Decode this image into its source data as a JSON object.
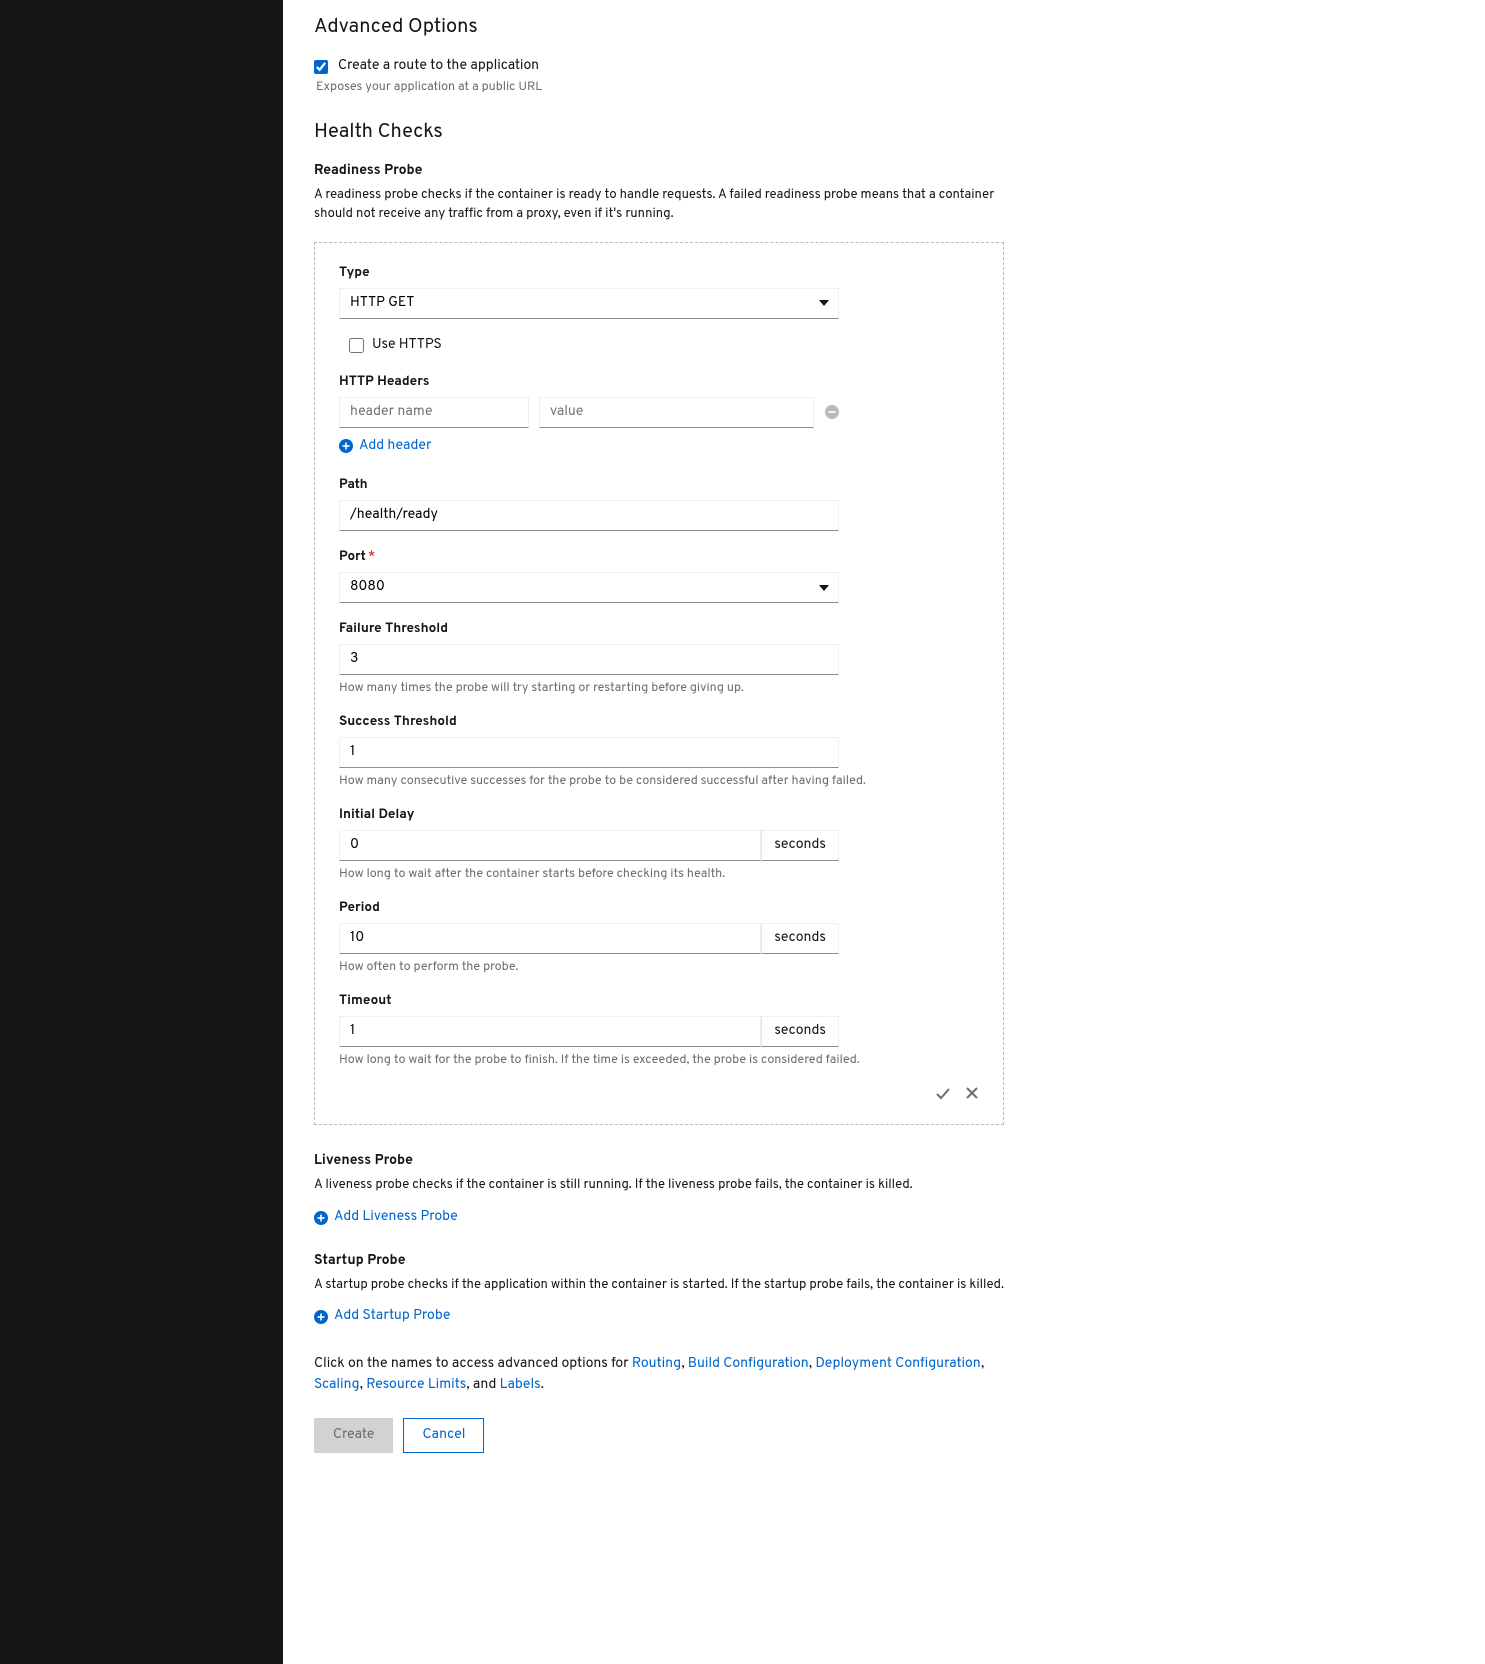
{
  "advanced_options": {
    "title": "Advanced Options",
    "create_route": {
      "label": "Create a route to the application",
      "checked": true,
      "help": "Exposes your application at a public URL"
    }
  },
  "health_checks": {
    "title": "Health Checks",
    "readiness": {
      "heading": "Readiness Probe",
      "description": "A readiness probe checks if the container is ready to handle requests. A failed readiness probe means that a container should not receive any traffic from a proxy, even if it's running.",
      "type_label": "Type",
      "type_value": "HTTP GET",
      "use_https_label": "Use HTTPS",
      "http_headers_label": "HTTP Headers",
      "header_name_placeholder": "header name",
      "header_value_placeholder": "value",
      "add_header_label": "Add header",
      "path_label": "Path",
      "path_value": "/health/ready",
      "port_label": "Port",
      "port_value": "8080",
      "failure_threshold_label": "Failure Threshold",
      "failure_threshold_value": "3",
      "failure_threshold_help": "How many times the probe will try starting or restarting before giving up.",
      "success_threshold_label": "Success Threshold",
      "success_threshold_value": "1",
      "success_threshold_help": "How many consecutive successes for the probe to be considered successful after having failed.",
      "initial_delay_label": "Initial Delay",
      "initial_delay_value": "0",
      "initial_delay_help": "How long to wait after the container starts before checking its health.",
      "period_label": "Period",
      "period_value": "10",
      "period_help": "How often to perform the probe.",
      "timeout_label": "Timeout",
      "timeout_value": "1",
      "timeout_help": "How long to wait for the probe to finish. If the time is exceeded, the probe is considered failed.",
      "seconds_label": "seconds"
    },
    "liveness": {
      "heading": "Liveness Probe",
      "description": "A liveness probe checks if the container is still running. If the liveness probe fails, the container is killed.",
      "add_label": "Add Liveness Probe"
    },
    "startup": {
      "heading": "Startup Probe",
      "description": "A startup probe checks if the application within the container is started. If the startup probe fails, the container is killed.",
      "add_label": "Add Startup Probe"
    }
  },
  "footer": {
    "prefix": "Click on the names to access advanced options for ",
    "links": {
      "routing": "Routing",
      "build": "Build Configuration",
      "deployment": "Deployment Configuration",
      "scaling": "Scaling",
      "resource": "Resource Limits",
      "labels": "Labels"
    },
    "and": ", and "
  },
  "buttons": {
    "create": "Create",
    "cancel": "Cancel"
  }
}
